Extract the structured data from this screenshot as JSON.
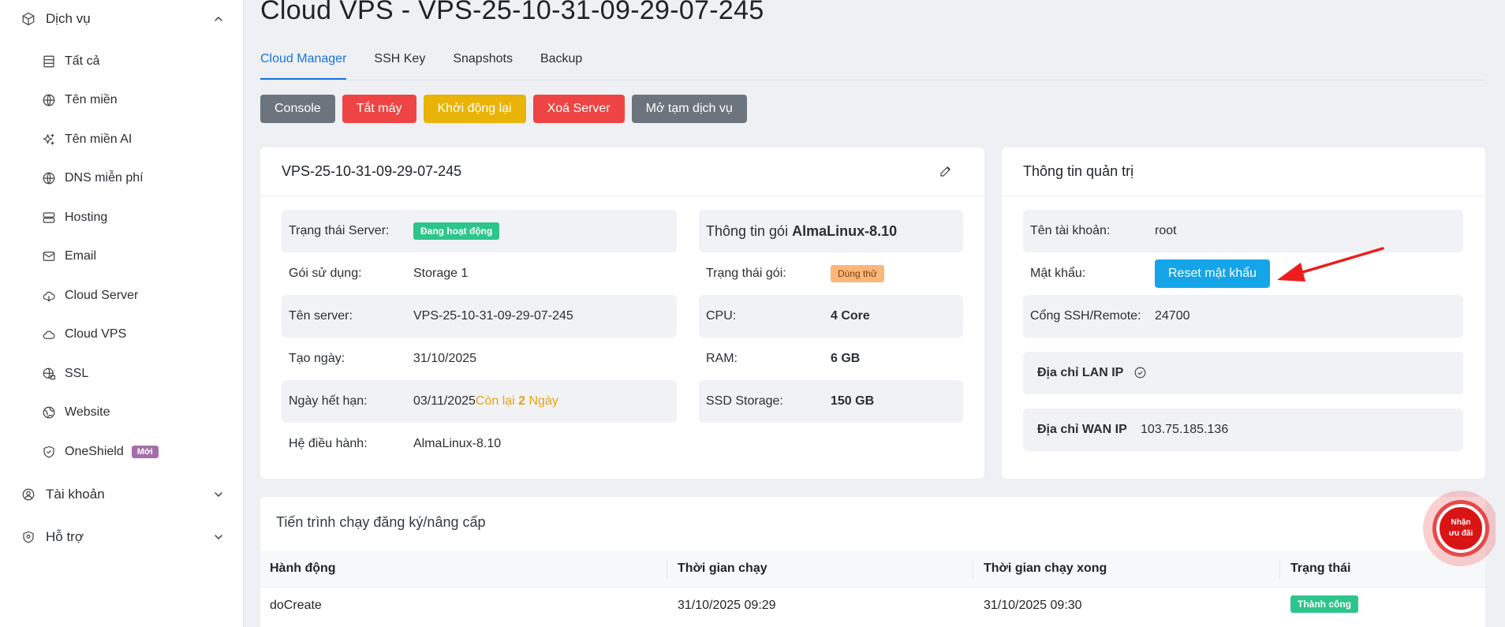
{
  "sidebar": {
    "group_services": "Dịch vụ",
    "items": [
      {
        "label": "Tất cả",
        "icon": "table-icon"
      },
      {
        "label": "Tên miền",
        "icon": "globe-icon"
      },
      {
        "label": "Tên miền AI",
        "icon": "sparkle-icon"
      },
      {
        "label": "DNS miễn phí",
        "icon": "globe-icon"
      },
      {
        "label": "Hosting",
        "icon": "server-icon"
      },
      {
        "label": "Email",
        "icon": "mail-icon"
      },
      {
        "label": "Cloud Server",
        "icon": "cloud-icon"
      },
      {
        "label": "Cloud VPS",
        "icon": "cloud-icon"
      },
      {
        "label": "SSL",
        "icon": "globe-lock-icon"
      },
      {
        "label": "Website",
        "icon": "website-icon"
      },
      {
        "label": "OneShield",
        "icon": "shield-icon",
        "badge": "Mới"
      }
    ],
    "group_account": "Tài khoản",
    "group_support": "Hỗ trợ"
  },
  "page": {
    "title": "Cloud VPS - VPS-25-10-31-09-29-07-245"
  },
  "tabs": [
    "Cloud Manager",
    "SSH Key",
    "Snapshots",
    "Backup"
  ],
  "actions": {
    "console": "Console",
    "shutdown": "Tắt máy",
    "restart": "Khởi động lại",
    "delete": "Xoá Server",
    "reopen": "Mở tạm dịch vụ"
  },
  "server_card": {
    "title": "VPS-25-10-31-09-29-07-245",
    "status_label": "Trạng thái Server:",
    "status_value": "Đang hoạt động",
    "plan_label": "Gói sử dụng:",
    "plan_value": "Storage 1",
    "name_label": "Tên server:",
    "name_value": "VPS-25-10-31-09-29-07-245",
    "created_label": "Tạo ngày:",
    "created_value": "31/10/2025",
    "expire_label": "Ngày hết hạn:",
    "expire_value": "03/11/2025",
    "remaining_prefix": "Còn lại ",
    "remaining_days": "2",
    "remaining_suffix": " Ngày",
    "os_label": "Hệ điều hành:",
    "os_value": "AlmaLinux-8.10",
    "package_title_prefix": "Thông tin gói ",
    "package_title_os": "AlmaLinux-8.10",
    "pkg_status_label": "Trạng thái gói:",
    "pkg_status_value": "Dùng thử",
    "cpu_label": "CPU:",
    "cpu_value": "4 Core",
    "ram_label": "RAM:",
    "ram_value": "6 GB",
    "ssd_label": "SSD Storage:",
    "ssd_value": "150 GB"
  },
  "admin_card": {
    "title": "Thông tin quản trị",
    "username_label": "Tên tài khoản:",
    "username_value": "root",
    "password_label": "Mật khẩu:",
    "reset_button": "Reset mật khẩu",
    "ssh_label": "Cổng SSH/Remote:",
    "ssh_value": "24700",
    "lan_label": "Địa chỉ LAN IP",
    "wan_label": "Địa chỉ WAN IP",
    "wan_value": "103.75.185.136"
  },
  "progress_card": {
    "title": "Tiến trình chạy đăng ký/nâng cấp",
    "columns": [
      "Hành động",
      "Thời gian chạy",
      "Thời gian chạy xong",
      "Trạng thái"
    ],
    "rows": [
      {
        "action": "doCreate",
        "start": "31/10/2025 09:29",
        "end": "31/10/2025 09:30",
        "status": "Thành công"
      }
    ]
  },
  "promo": {
    "line1": "Nhận",
    "line2": "ưu đãi"
  },
  "colors": {
    "accent": "#1a73d9",
    "danger": "#ef4444",
    "warning": "#eab308",
    "success": "#2ec58a",
    "info": "#14a4e8"
  }
}
